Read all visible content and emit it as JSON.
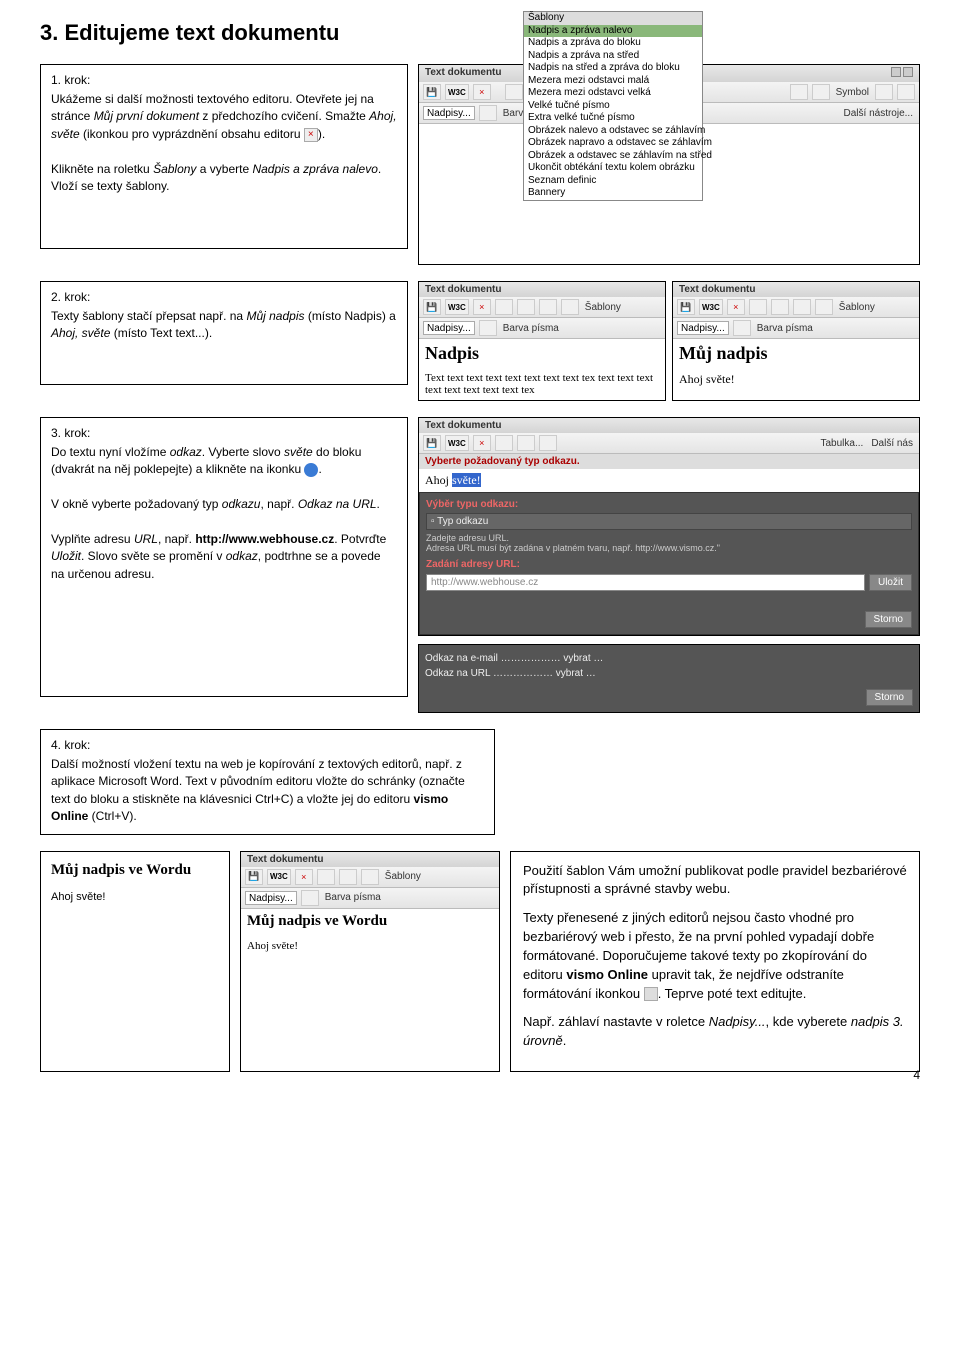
{
  "page_title": "3. Editujeme text dokumentu",
  "page_number": "4",
  "step1": {
    "title": "1. krok:",
    "p1a": "Ukážeme si další možnosti textového editoru. Otevřete jej na stránce ",
    "p1b": "Můj první dokument",
    "p1c": " z předchozího cvičení. Smažte ",
    "p1d": "Ahoj, světe",
    "p1e": " (ikonkou pro vyprázdnění obsahu editoru ",
    "p1f": ").",
    "p2a": "Klikněte na roletku ",
    "p2b": "Šablony",
    "p2c": " a vyberte ",
    "p2d": "Nadpis a zpráva nalevo",
    "p2e": ". Vloží se texty šablony."
  },
  "step2": {
    "title": "2. krok:",
    "p1a": "Texty šablony stačí přepsat např. na ",
    "p1b": "Můj nadpis",
    "p1c": " (místo Nadpis) a ",
    "p1d": "Ahoj, světe",
    "p1e": " (místo Text text...)."
  },
  "step3": {
    "title": "3. krok:",
    "p1a": "Do textu nyní vložíme ",
    "p1b": "odkaz",
    "p1c": ". Vyberte slovo ",
    "p1d": "světe",
    "p1e": " do bloku (dvakrát na něj poklepejte) a klikněte na ikonku ",
    "p1f": ".",
    "p2a": "V okně vyberte požadovaný typ ",
    "p2b": "odkazu",
    "p2c": ", např. ",
    "p2d": "Odkaz na URL",
    "p2e": ".",
    "p3a": "Vyplňte adresu ",
    "p3b": "URL",
    "p3c": ", např. ",
    "p3d": "http://www.webhouse.cz",
    "p3e": ". Potvrďte ",
    "p3f": "Uložit",
    "p3g": ". Slovo světe se promění v ",
    "p3h": "odkaz",
    "p3i": ", podtrhne se a povede na určenou adresu."
  },
  "step4": {
    "title": "4. krok:",
    "p1a": "Další možností vložení textu na web je kopírování z textových editorů, např. z aplikace Microsoft Word. Text v původním editoru vložte do schránky (označte text do bloku a stiskněte na klávesnici Ctrl+C) a vložte jej do editoru ",
    "p1b": "vismo Online",
    "p1c": " (Ctrl+V)."
  },
  "ss_shared": {
    "title": "Text dokumentu",
    "w3c": "W3C",
    "sablony_label": "Šablony",
    "nadpisy": "Nadpisy...",
    "barva": "Barva písma",
    "symbol": "Symbol",
    "dalsi": "Další nástroje...",
    "tabulka": "Tabulka...",
    "dalsi_nas": "Další nás"
  },
  "ss1_dropdown": {
    "header": "Šablony",
    "items": [
      "Nadpis a zpráva nalevo",
      "Nadpis a zpráva do bloku",
      "Nadpis a zpráva na střed",
      "Nadpis na střed a zpráva do bloku",
      "Mezera mezi odstavci malá",
      "Mezera mezi odstavci velká",
      "Velké tučné písmo",
      "Extra velké tučné písmo",
      "Obrázek nalevo a odstavec se záhlavím",
      "Obrázek napravo a odstavec se záhlavím",
      "Obrázek a odstavec se záhlavím na střed",
      "Ukončit obtékání textu kolem obrázku",
      "Seznam definic",
      "Bannery"
    ]
  },
  "ss2a": {
    "heading": "Nadpis",
    "body": "Text text text text text text text text tex text text text text text text text text tex"
  },
  "ss2b": {
    "heading": "Můj nadpis",
    "body": "Ahoj světe!"
  },
  "ss3": {
    "ahoj": "Ahoj",
    "svete": "světe!",
    "red_popup": "Vyberte požadovaný typ odkazu.",
    "red_title": "Výběr typu odkazu:",
    "typ_odkazu": "Typ odkazu",
    "sub1": "Zadejte adresu URL.",
    "sub2": "Adresa URL musí být zadána v platném tvaru, např. http://www.vismo.cz.\"",
    "red_title2": "Zadání adresy URL:",
    "url_value": "http://www.webhouse.cz",
    "ulozit": "Uložit",
    "storno": "Storno",
    "option1": "Odkaz na e-mail ……………… vybrat …",
    "option2": "Odkaz na URL ……………… vybrat …"
  },
  "word_box": {
    "title": "Můj nadpis ve Wordu",
    "sub": "Ahoj světe!"
  },
  "word_ss": {
    "heading": "Můj nadpis ve Wordu",
    "body": "Ahoj světe!"
  },
  "info": {
    "p1": "Použití šablon Vám umožní publikovat podle pravidel bezbariérové přístupnosti a správné stavby webu.",
    "p2a": "Texty přenesené z jiných editorů nejsou často vhodné pro bezbariérový web i přesto, že na první pohled vypadají dobře formátované. Doporučujeme takové texty po zkopírování do editoru ",
    "p2b": "vismo Online",
    "p2c": " upravit tak, že nejdříve odstraníte formátování ikonkou ",
    "p2d": ". Teprve poté text editujte.",
    "p3a": "Např. záhlaví nastavte v roletce ",
    "p3b": "Nadpisy...",
    "p3c": ", kde vyberete ",
    "p3d": "nadpis 3. úrovně",
    "p3e": "."
  }
}
